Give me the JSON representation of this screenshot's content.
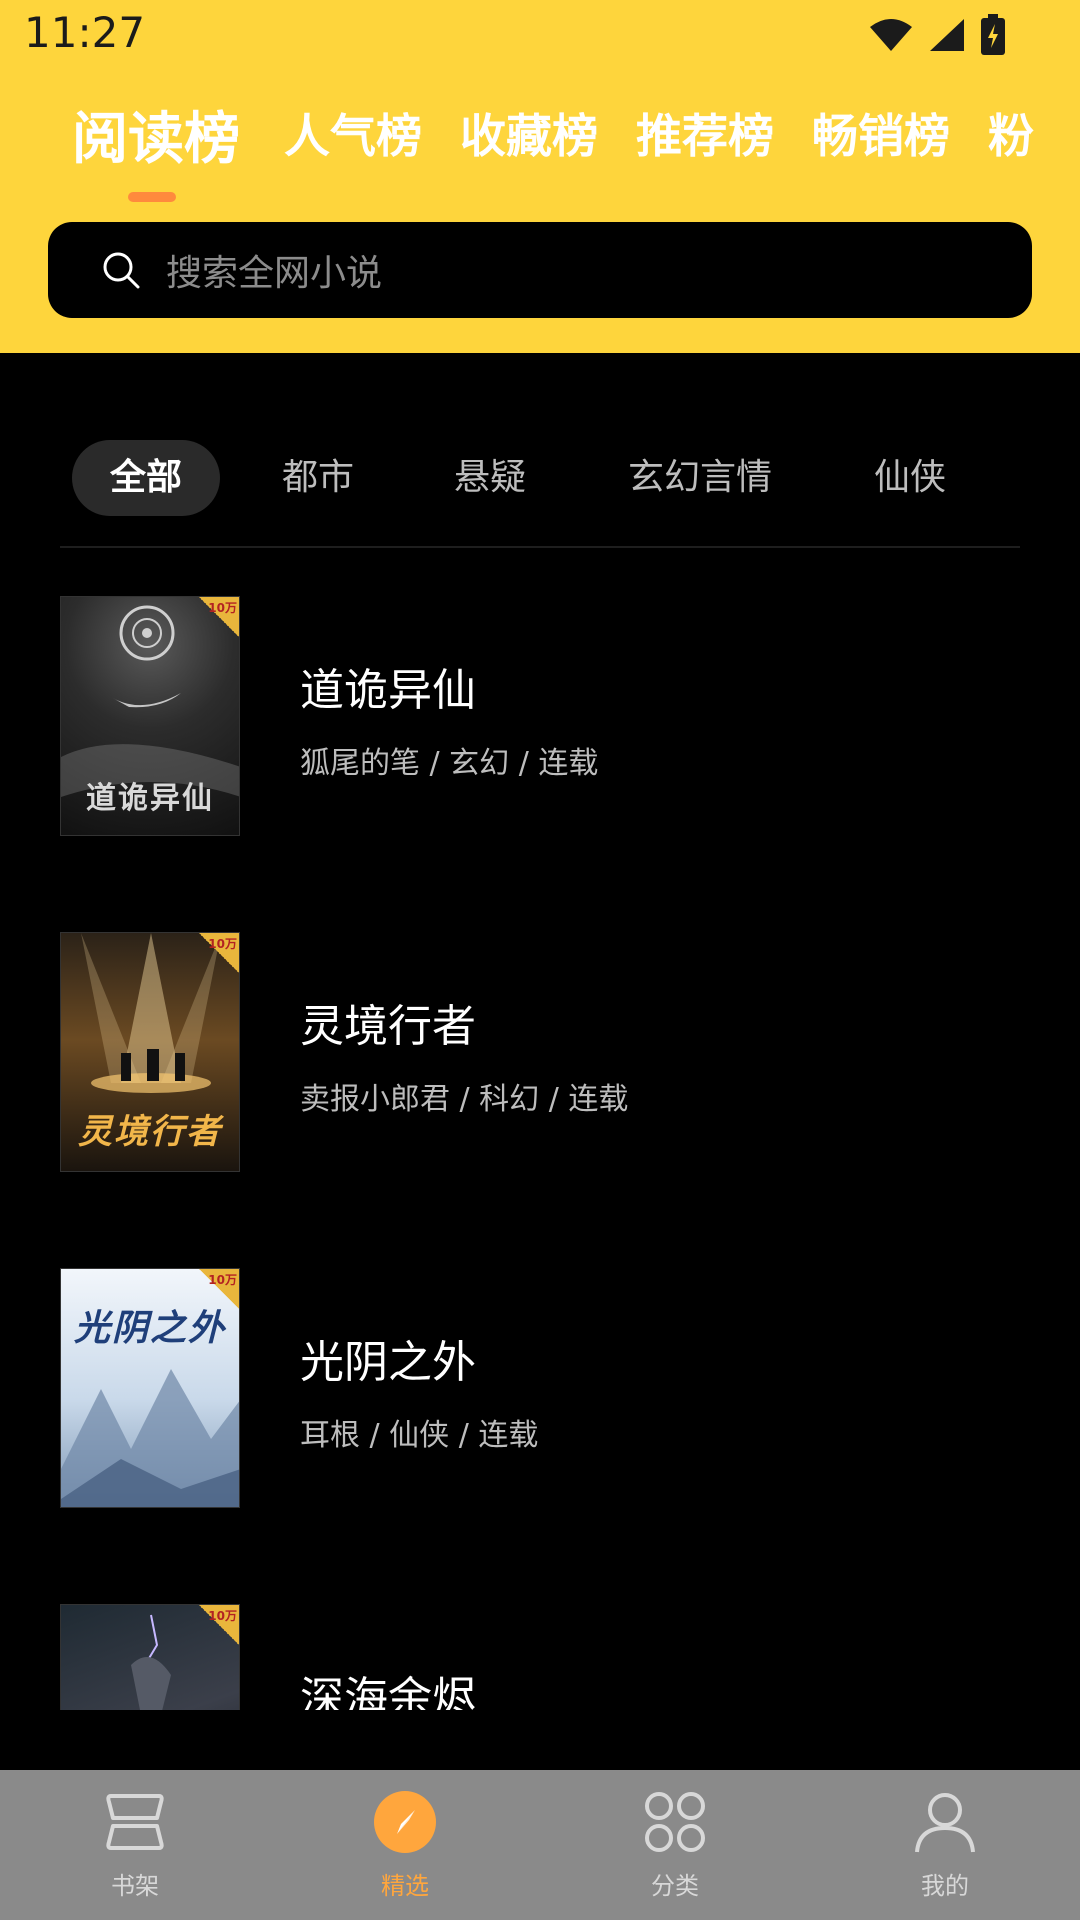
{
  "status_bar": {
    "time": "11:27",
    "icons": [
      "wifi-icon",
      "signal-icon",
      "battery-charging-icon"
    ]
  },
  "rank_tabs": [
    {
      "label": "阅读榜",
      "active": true
    },
    {
      "label": "人气榜",
      "active": false
    },
    {
      "label": "收藏榜",
      "active": false
    },
    {
      "label": "推荐榜",
      "active": false
    },
    {
      "label": "畅销榜",
      "active": false
    },
    {
      "label": "粉",
      "active": false
    }
  ],
  "search": {
    "placeholder": "搜索全网小说",
    "icon": "search-icon"
  },
  "categories": [
    {
      "label": "全部",
      "active": true
    },
    {
      "label": "都市",
      "active": false
    },
    {
      "label": "悬疑",
      "active": false
    },
    {
      "label": "玄幻言情",
      "active": false
    },
    {
      "label": "仙侠",
      "active": false
    }
  ],
  "books": [
    {
      "title": "道诡异仙",
      "meta": "狐尾的笔 / 玄幻 / 连载",
      "badge": "10万",
      "cover_text": "道诡异仙"
    },
    {
      "title": "灵境行者",
      "meta": "卖报小郎君 / 科幻 / 连载",
      "badge": "10万",
      "cover_text": "灵境行者"
    },
    {
      "title": "光阴之外",
      "meta": "耳根 / 仙侠 / 连载",
      "badge": "10万",
      "cover_text": "光阴之外"
    },
    {
      "title": "深海余烬",
      "meta": "",
      "badge": "10万",
      "cover_text": ""
    }
  ],
  "bottom_nav": [
    {
      "label": "书架",
      "icon": "bookshelf-icon",
      "active": false
    },
    {
      "label": "精选",
      "icon": "compass-icon",
      "active": true
    },
    {
      "label": "分类",
      "icon": "category-grid-icon",
      "active": false
    },
    {
      "label": "我的",
      "icon": "profile-icon",
      "active": false
    }
  ],
  "colors": {
    "header": "#FED53C",
    "accent": "#FFA63D",
    "background": "#000000"
  }
}
